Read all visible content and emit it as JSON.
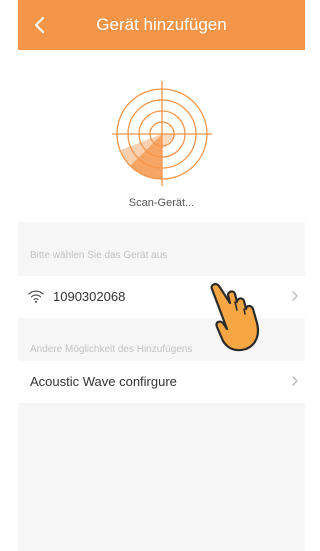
{
  "header": {
    "back_icon": "chevron-left-icon",
    "title": "Gerät hinzufügen",
    "color": "#f5954a"
  },
  "scan": {
    "icon": "radar-icon",
    "status": "Scan-Gerät..."
  },
  "device_section": {
    "label": "Bitte wählen Sie das Gerät aus",
    "devices": [
      {
        "icon": "wifi-icon",
        "name": "1090302068"
      }
    ]
  },
  "other_section": {
    "label": "Andere Möglichkeit des Hinzufügens",
    "options": [
      {
        "name": "Acoustic Wave confirgure"
      }
    ]
  },
  "overlay": {
    "icon": "pointing-hand-icon"
  }
}
